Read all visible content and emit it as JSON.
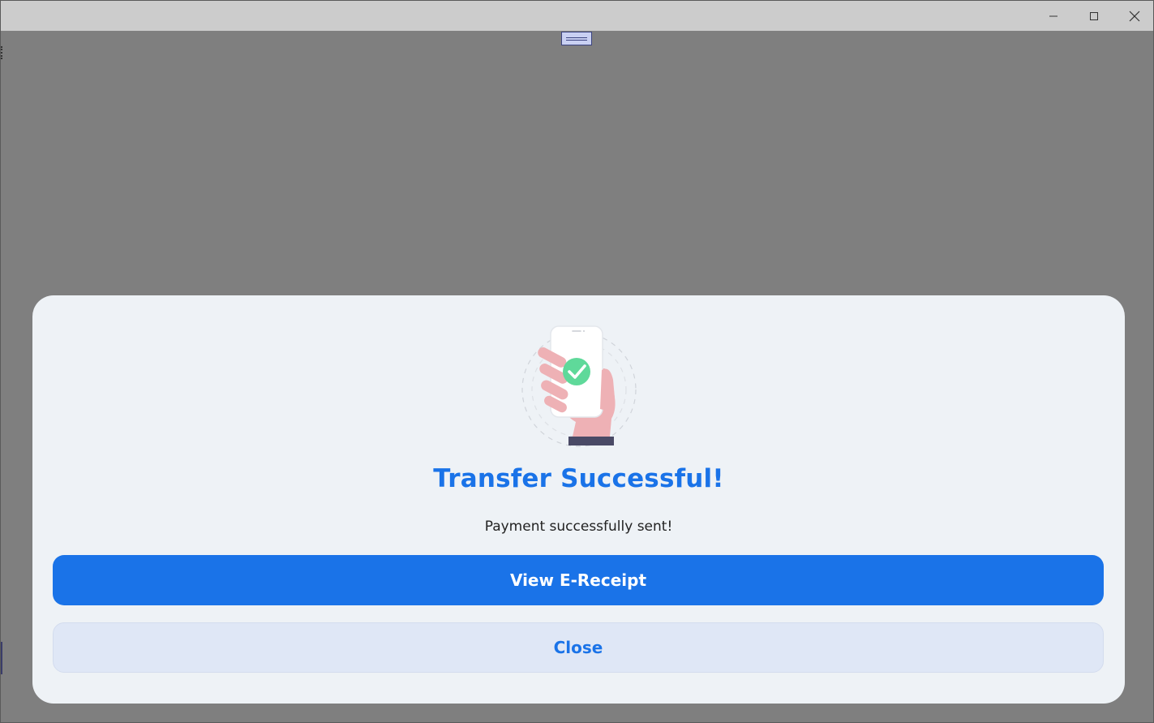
{
  "window": {
    "controls": {
      "minimize_icon": "minimize-icon",
      "maximize_icon": "maximize-icon",
      "close_icon": "close-icon"
    }
  },
  "dialog": {
    "illustration_icon": "phone-check-icon",
    "title": "Transfer Successful!",
    "message": "Payment successfully sent!",
    "primary_button": "View E-Receipt",
    "secondary_button": "Close"
  },
  "colors": {
    "accent": "#1a73e8",
    "overlay": "#7f7f7f",
    "dialog_bg": "#eef2f6",
    "secondary_button_bg": "#dfe7f6",
    "success": "#5fd99a"
  }
}
